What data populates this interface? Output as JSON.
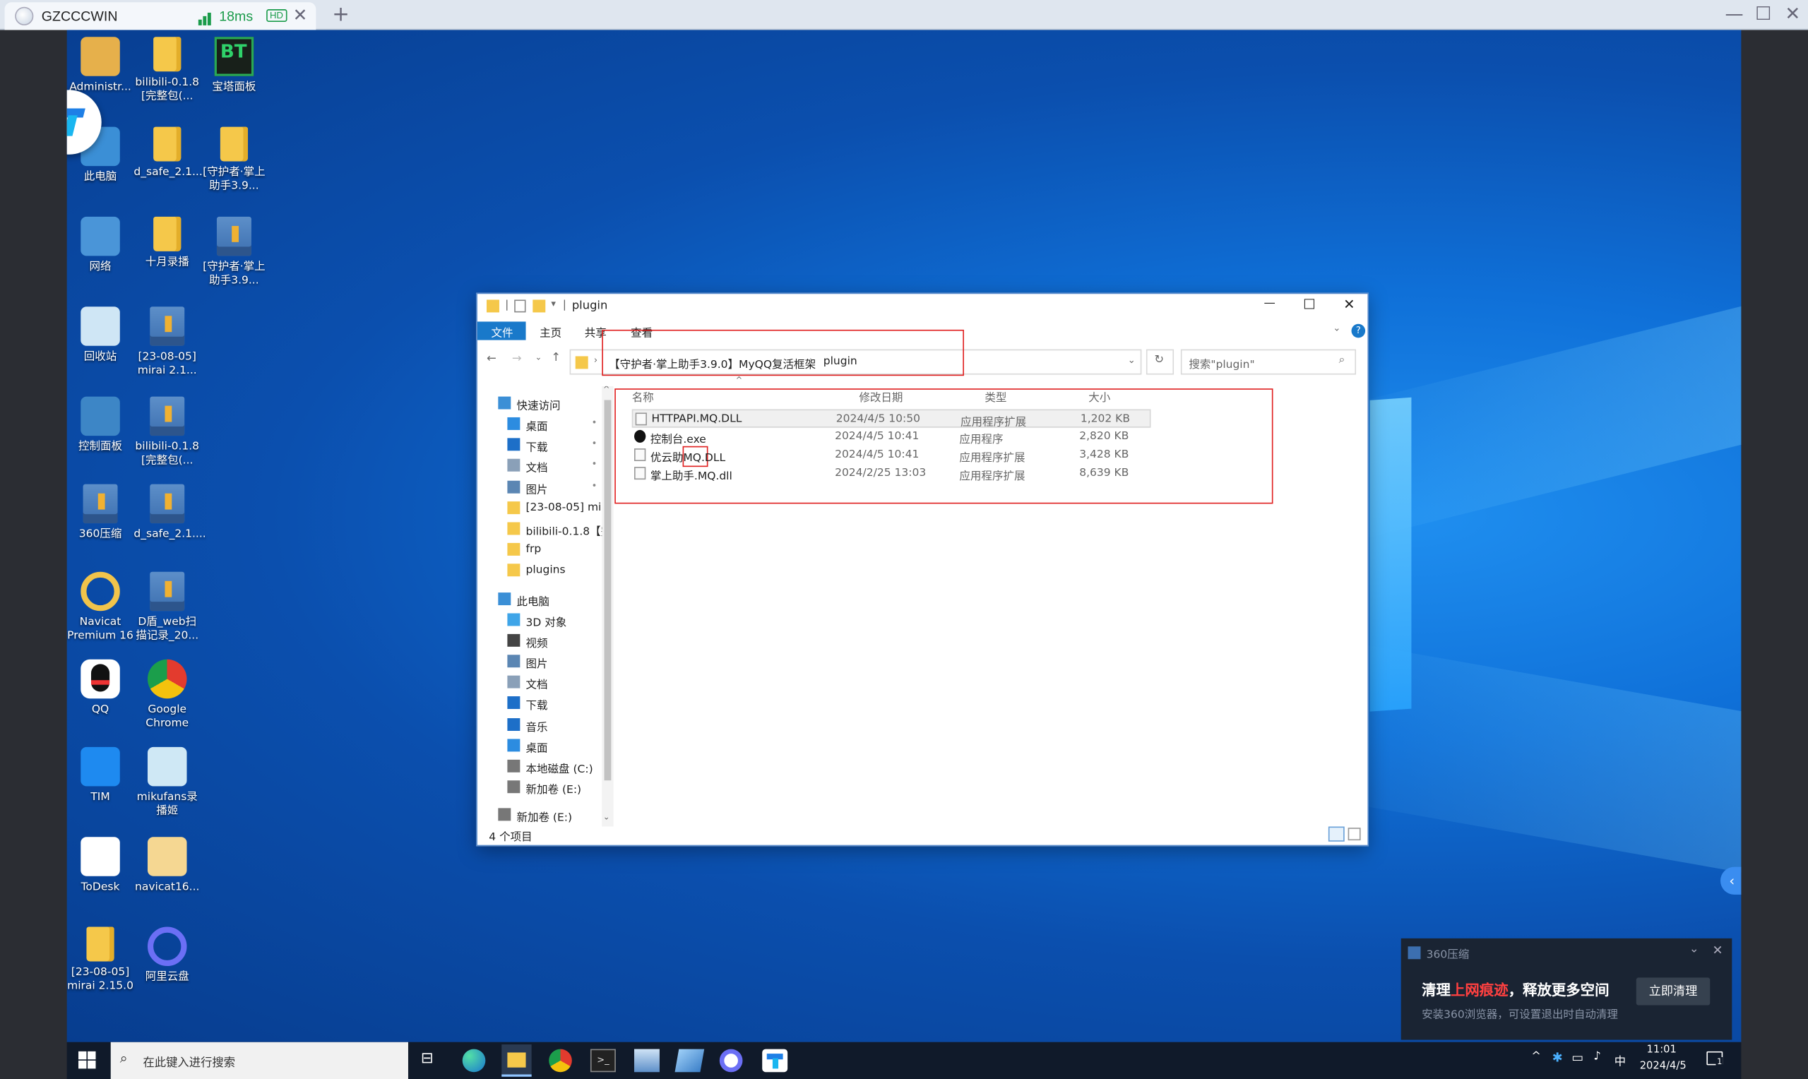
{
  "remote": {
    "host": "GZCCCWIN",
    "latency": "18ms",
    "hd_badge": "HD",
    "new_tab": "+"
  },
  "desktop_icons": [
    {
      "label": "Administr...",
      "kind": "user"
    },
    {
      "label": "bilibili-0.1.8 [完整包(...",
      "kind": "folder"
    },
    {
      "label": "宝塔面板",
      "kind": "bt"
    },
    {
      "label": "此电脑",
      "kind": "pc"
    },
    {
      "label": "d_safe_2.1....",
      "kind": "folder"
    },
    {
      "label": "[守护者·掌上助手3.9...",
      "kind": "folder"
    },
    {
      "label": "网络",
      "kind": "net"
    },
    {
      "label": "十月录播",
      "kind": "folder"
    },
    {
      "label": "[守护者·掌上助手3.9...",
      "kind": "zip"
    },
    {
      "label": "回收站",
      "kind": "bin"
    },
    {
      "label": "[23-08-05] mirai 2.1...",
      "kind": "zip"
    },
    {
      "label": "控制面板",
      "kind": "cp"
    },
    {
      "label": "bilibili-0.1.8 [完整包(...",
      "kind": "zip"
    },
    {
      "label": "360压缩",
      "kind": "zip"
    },
    {
      "label": "d_safe_2.1....",
      "kind": "zip"
    },
    {
      "label": "Navicat Premium 16",
      "kind": "navicat"
    },
    {
      "label": "D盾_web扫描记录_20...",
      "kind": "zip"
    },
    {
      "label": "QQ",
      "kind": "qq"
    },
    {
      "label": "Google Chrome",
      "kind": "chrome"
    },
    {
      "label": "TIM",
      "kind": "tim"
    },
    {
      "label": "mikufans录播姬",
      "kind": "miku"
    },
    {
      "label": "ToDesk",
      "kind": "todesk"
    },
    {
      "label": "navicat16...",
      "kind": "navicat16"
    },
    {
      "label": "[23-08-05] mirai 2.15.0",
      "kind": "folder"
    },
    {
      "label": "阿里云盘",
      "kind": "aliyun"
    }
  ],
  "explorer": {
    "title": "plugin",
    "tabs": [
      "文件",
      "主页",
      "共享",
      "查看"
    ],
    "breadcrumb": [
      "【守护者·掌上助手3.9.0】MyQQ复活框架",
      "plugin"
    ],
    "search_placeholder": "搜索\"plugin\"",
    "columns": [
      "名称",
      "修改日期",
      "类型",
      "大小"
    ],
    "files": [
      {
        "name": "HTTPAPI.MQ.DLL",
        "date": "2024/4/5 10:50",
        "type": "应用程序扩展",
        "size": "1,202 KB",
        "icon": "dll"
      },
      {
        "name": "控制台.exe",
        "date": "2024/4/5 10:41",
        "type": "应用程序",
        "size": "2,820 KB",
        "icon": "exe"
      },
      {
        "name": "优云助MQ.DLL",
        "date": "2024/4/5 10:41",
        "type": "应用程序扩展",
        "size": "3,428 KB",
        "icon": "dll"
      },
      {
        "name": "掌上助手.MQ.dll",
        "date": "2024/2/25 13:03",
        "type": "应用程序扩展",
        "size": "8,639 KB",
        "icon": "dll"
      }
    ],
    "nav_quick_access": "快速访问",
    "nav_quick": [
      {
        "label": "桌面",
        "icon": "desktop",
        "pinned": true
      },
      {
        "label": "下载",
        "icon": "download",
        "pinned": true
      },
      {
        "label": "文档",
        "icon": "doc",
        "pinned": true
      },
      {
        "label": "图片",
        "icon": "pic",
        "pinned": true
      },
      {
        "label": "[23-08-05] mira",
        "icon": "folder",
        "pinned": false
      },
      {
        "label": "bilibili-0.1.8【完",
        "icon": "folder",
        "pinned": false
      },
      {
        "label": "frp",
        "icon": "folder",
        "pinned": false
      },
      {
        "label": "plugins",
        "icon": "folder",
        "pinned": false
      }
    ],
    "nav_this_pc": "此电脑",
    "nav_pc": [
      {
        "label": "3D 对象",
        "icon": "3d"
      },
      {
        "label": "视频",
        "icon": "video"
      },
      {
        "label": "图片",
        "icon": "pic"
      },
      {
        "label": "文档",
        "icon": "doc"
      },
      {
        "label": "下载",
        "icon": "download"
      },
      {
        "label": "音乐",
        "icon": "music"
      },
      {
        "label": "桌面",
        "icon": "desktop"
      },
      {
        "label": "本地磁盘 (C:)",
        "icon": "drive"
      },
      {
        "label": "新加卷 (E:)",
        "icon": "drive"
      }
    ],
    "nav_extra": "新加卷 (E:)",
    "status": "4 个项目",
    "pin_glyph": "📌"
  },
  "taskbar": {
    "search_placeholder": "在此键入进行搜索",
    "time": "11:01",
    "date": "2024/4/5",
    "ime": "中",
    "notif_count": "1"
  },
  "popup": {
    "app": "360压缩",
    "headline_pre": "清理",
    "headline_red": "上网痕迹",
    "headline_post": "，释放更多空间",
    "sub": "安装360浏览器，可设置退出时自动清理",
    "button": "立即清理"
  },
  "colors": {
    "accent": "#1979ca",
    "red_box": "#e02020",
    "taskbar": "#101a2a"
  }
}
